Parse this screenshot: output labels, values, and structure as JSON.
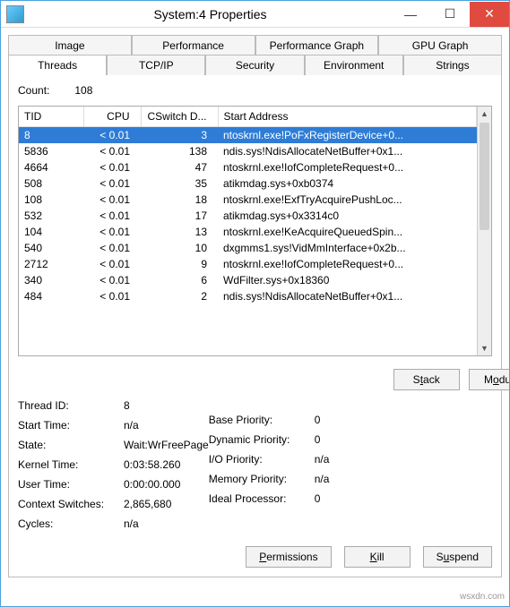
{
  "window": {
    "title": "System:4 Properties"
  },
  "tabs": {
    "row1": [
      "Image",
      "Performance",
      "Performance Graph",
      "GPU Graph"
    ],
    "row2": [
      "Threads",
      "TCP/IP",
      "Security",
      "Environment",
      "Strings"
    ]
  },
  "threads": {
    "count_label": "Count:",
    "count": "108",
    "columns": [
      "TID",
      "CPU",
      "CSwitch D...",
      "Start Address"
    ],
    "rows": [
      {
        "tid": "8",
        "cpu": "< 0.01",
        "cswitch": "3",
        "start": "ntoskrnl.exe!PoFxRegisterDevice+0...",
        "selected": true
      },
      {
        "tid": "5836",
        "cpu": "< 0.01",
        "cswitch": "138",
        "start": "ndis.sys!NdisAllocateNetBuffer+0x1..."
      },
      {
        "tid": "4664",
        "cpu": "< 0.01",
        "cswitch": "47",
        "start": "ntoskrnl.exe!IofCompleteRequest+0..."
      },
      {
        "tid": "508",
        "cpu": "< 0.01",
        "cswitch": "35",
        "start": "atikmdag.sys+0xb0374"
      },
      {
        "tid": "108",
        "cpu": "< 0.01",
        "cswitch": "18",
        "start": "ntoskrnl.exe!ExfTryAcquirePushLoc..."
      },
      {
        "tid": "532",
        "cpu": "< 0.01",
        "cswitch": "17",
        "start": "atikmdag.sys+0x3314c0"
      },
      {
        "tid": "104",
        "cpu": "< 0.01",
        "cswitch": "13",
        "start": "ntoskrnl.exe!KeAcquireQueuedSpin..."
      },
      {
        "tid": "540",
        "cpu": "< 0.01",
        "cswitch": "10",
        "start": "dxgmms1.sys!VidMmInterface+0x2b..."
      },
      {
        "tid": "2712",
        "cpu": "< 0.01",
        "cswitch": "9",
        "start": "ntoskrnl.exe!IofCompleteRequest+0..."
      },
      {
        "tid": "340",
        "cpu": "< 0.01",
        "cswitch": "6",
        "start": "WdFilter.sys+0x18360"
      },
      {
        "tid": "484",
        "cpu": "< 0.01",
        "cswitch": "2",
        "start": "ndis.sys!NdisAllocateNetBuffer+0x1..."
      }
    ]
  },
  "detail": {
    "left": [
      {
        "label": "Thread ID:",
        "value": "8"
      },
      {
        "label": "Start Time:",
        "value": "n/a"
      },
      {
        "label": "State:",
        "value": "Wait:WrFreePage"
      },
      {
        "label": "Kernel Time:",
        "value": "0:03:58.260"
      },
      {
        "label": "User Time:",
        "value": "0:00:00.000"
      },
      {
        "label": "Context Switches:",
        "value": "2,865,680"
      },
      {
        "label": "Cycles:",
        "value": "n/a"
      }
    ],
    "right": [
      {
        "label": "",
        "value": ""
      },
      {
        "label": "",
        "value": ""
      },
      {
        "label": "Base Priority:",
        "value": "0"
      },
      {
        "label": "Dynamic Priority:",
        "value": "0"
      },
      {
        "label": "I/O Priority:",
        "value": "n/a"
      },
      {
        "label": "Memory Priority:",
        "value": "n/a"
      },
      {
        "label": "Ideal Processor:",
        "value": "0"
      }
    ]
  },
  "buttons": {
    "stack_pre": "S",
    "stack_u": "t",
    "stack_post": "ack",
    "module_pre": "M",
    "module_u": "o",
    "module_post": "dule",
    "permissions_u": "P",
    "permissions_post": "ermissions",
    "kill_u": "K",
    "kill_post": "ill",
    "suspend_pre": "S",
    "suspend_u": "u",
    "suspend_post": "spend"
  },
  "watermark": "wsxdn.com"
}
